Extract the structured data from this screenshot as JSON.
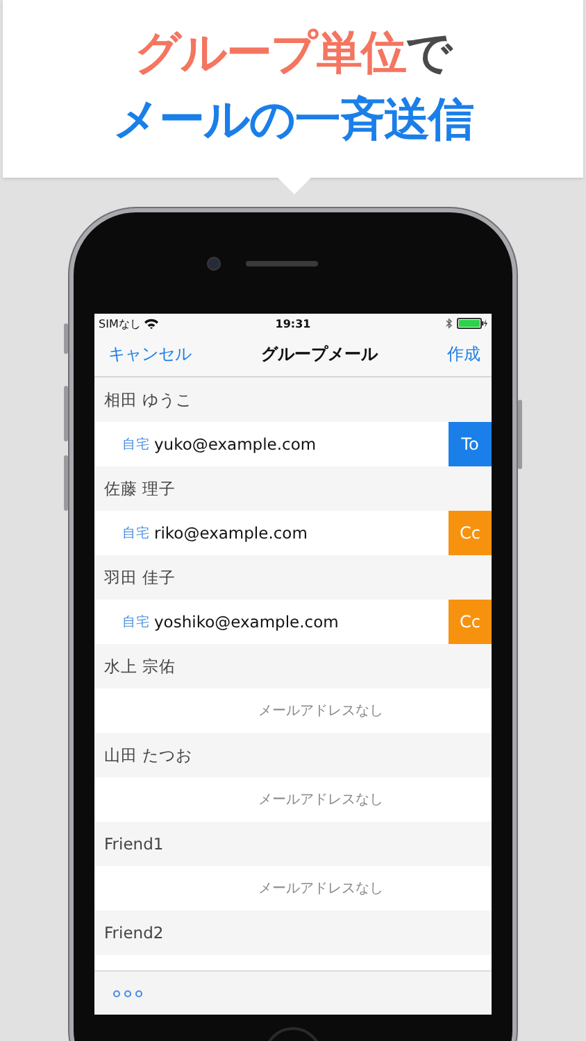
{
  "headline": {
    "lines": [
      [
        {
          "text": "グループ単位",
          "color": "#f47560"
        },
        {
          "text": "で",
          "color": "#4a4a4a"
        }
      ],
      [
        {
          "text": "メールの一斉送信",
          "color": "#1a7fe8"
        }
      ]
    ]
  },
  "status_bar": {
    "carrier": "SIMなし",
    "time": "19:31"
  },
  "nav": {
    "left": "キャンセル",
    "title": "グループメール",
    "right": "作成"
  },
  "contacts": [
    {
      "name": "相田 ゆうこ",
      "kind": "email",
      "label": "自宅",
      "address": "yuko@example.com",
      "role": "To",
      "color": "#1a7fe8"
    },
    {
      "name": "佐藤 理子",
      "kind": "email",
      "label": "自宅",
      "address": "riko@example.com",
      "role": "Cc",
      "color": "#f7920f"
    },
    {
      "name": "羽田 佳子",
      "kind": "email",
      "label": "自宅",
      "address": "yoshiko@example.com",
      "role": "Cc",
      "color": "#f7920f"
    },
    {
      "name": "水上 宗佑",
      "kind": "none",
      "message": "メールアドレスなし"
    },
    {
      "name": "山田 たつお",
      "kind": "none",
      "message": "メールアドレスなし"
    },
    {
      "name": "Friend1",
      "kind": "none",
      "message": "メールアドレスなし"
    },
    {
      "name": "Friend2",
      "kind": "cut"
    }
  ]
}
